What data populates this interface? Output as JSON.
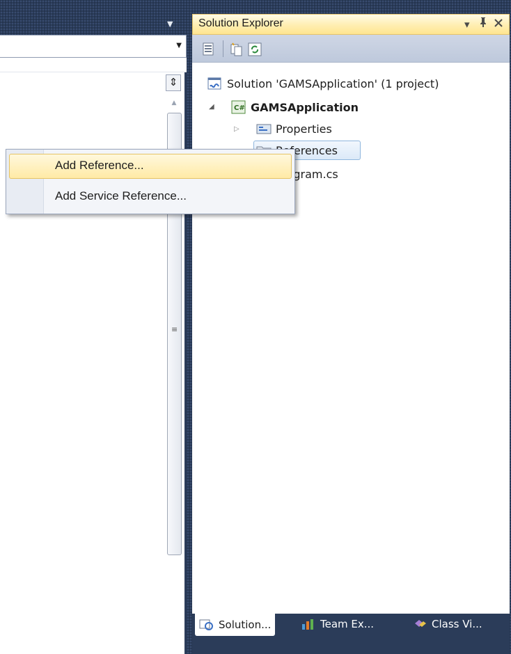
{
  "editor": {
    "dropdown_icon": "chevron-down-icon",
    "split_icon": "split-window-icon"
  },
  "solution_explorer": {
    "title": "Solution Explorer",
    "title_buttons": {
      "dropdown": "▾",
      "pin": "pin-icon",
      "close": "close-icon"
    },
    "toolbar": [
      {
        "name": "properties-icon"
      },
      {
        "name": "show-all-files-icon"
      },
      {
        "name": "refresh-icon"
      }
    ],
    "tree": {
      "solution": "Solution 'GAMSApplication' (1 project)",
      "project": "GAMSApplication",
      "properties": "Properties",
      "references": "References",
      "program": "Program.cs"
    },
    "tabs": [
      {
        "label": "Solution...",
        "active": true,
        "icon": "solution-explorer-icon"
      },
      {
        "label": "Team Ex...",
        "active": false,
        "icon": "team-explorer-icon"
      },
      {
        "label": "Class Vi...",
        "active": false,
        "icon": "class-view-icon"
      }
    ]
  },
  "context_menu": {
    "items": [
      {
        "label": "Add Reference...",
        "highlighted": true
      },
      {
        "label": "Add Service Reference...",
        "highlighted": false
      }
    ]
  },
  "colors": {
    "chrome": "#2b3c59",
    "title_active": "#ffeeb1",
    "menu_highlight": "#ffeaa6"
  }
}
